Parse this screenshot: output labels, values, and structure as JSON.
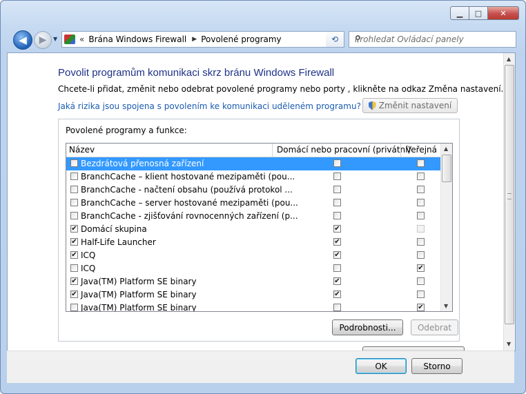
{
  "window": {
    "controls": {
      "minimize": "▁",
      "maximize": "□",
      "close": "✕"
    }
  },
  "nav": {
    "back": "◀",
    "forward": "▶",
    "breadcrumb_chevron": "«",
    "breadcrumb": [
      "Brána Windows Firewall",
      "Povolené programy"
    ],
    "separator": "▶",
    "search_placeholder": "Prohledat Ovládací panely"
  },
  "main": {
    "title": "Povolit programům komunikaci skrz bránu Windows Firewall",
    "description": "Chcete-li přidat, změnit nebo odebrat povolené programy nebo porty , klikněte na odkaz Změna nastavení.",
    "risk_link": "Jaká rizika jsou spojena s povolením ke komunikaci udĕleném programu?",
    "change_settings": "Změnit nastavení",
    "group_label": "Povolené programy a funkce:",
    "columns": {
      "name": "Název",
      "domestic": "Domácí nebo pracovní (privátní)",
      "public": "Veřejná"
    },
    "programs": [
      {
        "name": "Bezdrátová přenosná zařízení",
        "enabled": false,
        "domestic": false,
        "public": false,
        "selected": true
      },
      {
        "name": "BranchCache – klient hostované mezipaměti (pou...",
        "enabled": false,
        "domestic": false,
        "public": false
      },
      {
        "name": "BranchCache - načtení obsahu (používá protokol ...",
        "enabled": false,
        "domestic": false,
        "public": false
      },
      {
        "name": "BranchCache – server hostované mezipaměti (pou...",
        "enabled": false,
        "domestic": false,
        "public": false
      },
      {
        "name": "BranchCache - zjišťování rovnocenných zařízení (p...",
        "enabled": false,
        "domestic": false,
        "public": false
      },
      {
        "name": "Domácí skupina",
        "enabled": true,
        "domestic": true,
        "public": false,
        "public_disabled": true
      },
      {
        "name": "Half-Life Launcher",
        "enabled": true,
        "domestic": true,
        "public": false
      },
      {
        "name": "ICQ",
        "enabled": true,
        "domestic": true,
        "public": false
      },
      {
        "name": "ICQ",
        "enabled": false,
        "domestic": false,
        "public": true
      },
      {
        "name": "Java(TM) Platform SE binary",
        "enabled": true,
        "domestic": true,
        "public": false
      },
      {
        "name": "Java(TM) Platform SE binary",
        "enabled": true,
        "domestic": true,
        "public": false
      },
      {
        "name": "Java(TM) Platform SE binary",
        "enabled": false,
        "domestic": false,
        "public": true
      }
    ],
    "details_button": "Podrobnosti...",
    "remove_button": "Odebrat"
  },
  "footer": {
    "ok": "OK",
    "cancel": "Storno"
  }
}
